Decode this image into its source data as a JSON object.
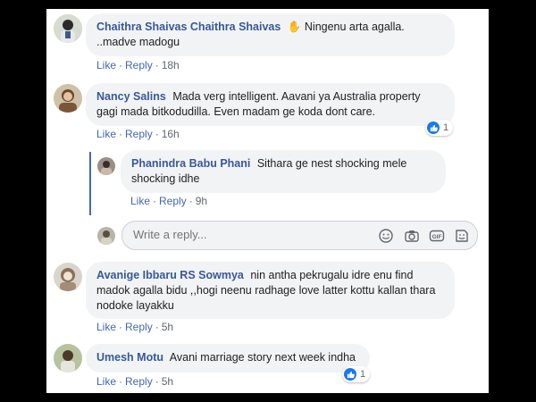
{
  "comments": [
    {
      "author": "Chaithra Shaivas Chaithra Shaivas",
      "text_emoji": "✋",
      "text": "Ningenu arta agalla.",
      "text2": "..madve madogu",
      "like": "Like",
      "reply": "Reply",
      "time": "18h"
    },
    {
      "author": "Nancy Salins",
      "text": "Mada verg intelligent. Aavani ya Australia property gagi mada bitkodudilla. Even madam ge koda dont care.",
      "like": "Like",
      "reply": "Reply",
      "time": "16h",
      "reactions": "1"
    },
    {
      "author": "Phanindra Babu Phani",
      "text": "Sithara ge nest shocking mele shocking idhe",
      "like": "Like",
      "reply": "Reply",
      "time": "9h"
    },
    {
      "author": "Avanige Ibbaru RS Sowmya",
      "text": "nin antha pekrugalu idre enu find madok agalla bidu ,,hogi neenu radhage love latter kottu kallan thara nodoke layakku",
      "like": "Like",
      "reply": "Reply",
      "time": "5h"
    },
    {
      "author": "Umesh Motu",
      "text": "Avani marriage story next week indha",
      "like": "Like",
      "reply": "Reply",
      "time": "5h",
      "reactions": "1"
    }
  ],
  "reply_box": {
    "placeholder": "Write a reply...",
    "icons": [
      "emoji-icon",
      "camera-icon",
      "gif-icon",
      "sticker-icon"
    ]
  },
  "colors": {
    "author": "#385898",
    "link": "#4267b2",
    "bubble": "#f2f3f5",
    "like_blue": "#1877f2"
  }
}
